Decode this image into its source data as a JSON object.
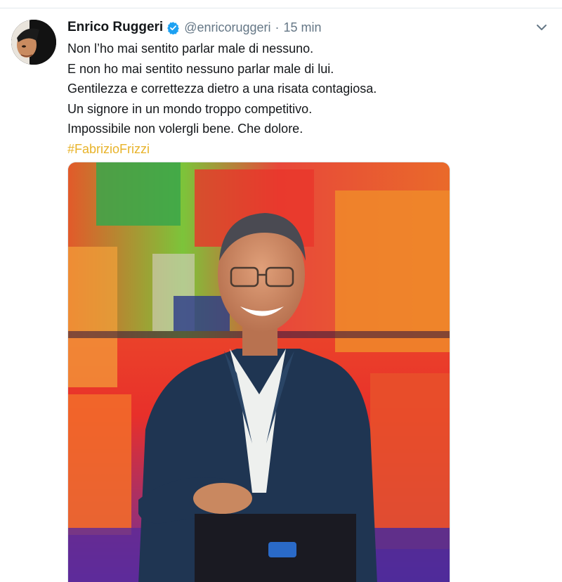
{
  "tweet": {
    "author": {
      "display_name": "Enrico Ruggeri",
      "handle": "@enricoruggeri",
      "verified": true,
      "verified_icon": "verified-badge-icon",
      "avatar_icon": "avatar-photo"
    },
    "separator": "·",
    "timestamp": "15 min",
    "lines": [
      "Non l’ho mai sentito parlar male di nessuno.",
      "E non ho mai sentito nessuno parlar male di lui.",
      "Gentilezza e correttezza dietro a una risata contagiosa.",
      "Un signore in un mondo troppo competitivo.",
      "Impossibile non volergli bene. Che dolore."
    ],
    "hashtag": "#FabrizioFrizzi",
    "more_menu_icon": "chevron-down-icon",
    "media_icon": "photo-smiling-man-in-blue-suit"
  },
  "colors": {
    "text": "#14171a",
    "secondary": "#657786",
    "verified": "#1da1f2",
    "hashtag": "#e8b32a",
    "divider": "#e1e8ed"
  }
}
